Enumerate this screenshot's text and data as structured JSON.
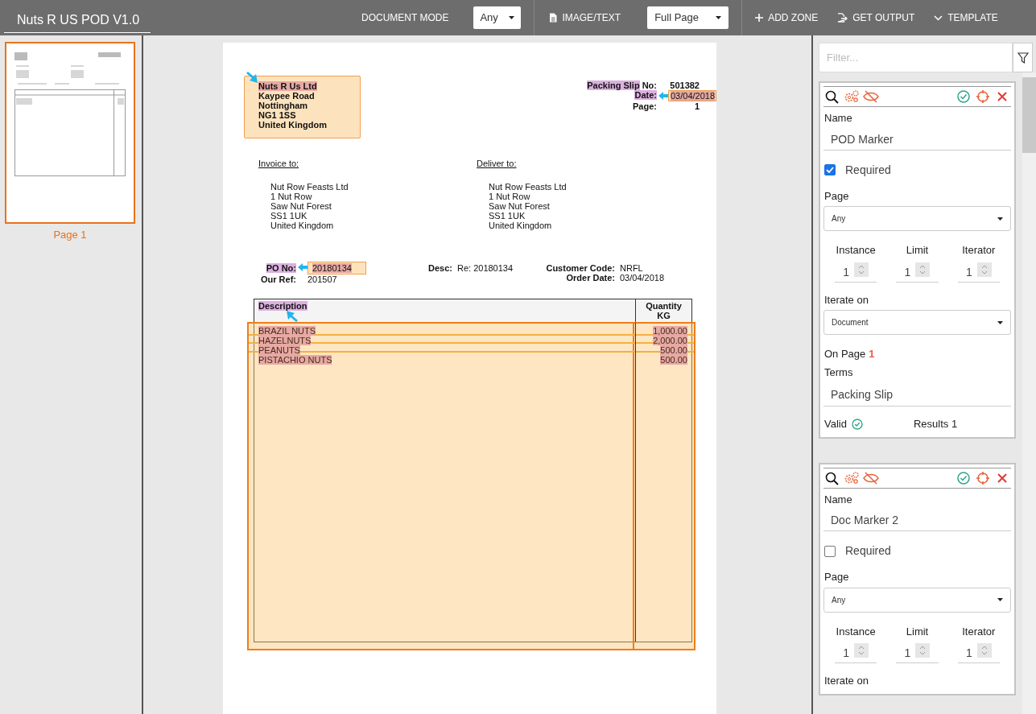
{
  "app": {
    "title": "Nuts R US POD V1.0"
  },
  "toolbar": {
    "mode_label": "DOCUMENT MODE",
    "mode": "Any",
    "image_text": "IMAGE/TEXT",
    "view": "Full Page",
    "actions": [
      {
        "kind": "plus",
        "label": "ADD ZONE"
      },
      {
        "kind": "output",
        "label": "GET OUTPUT"
      },
      {
        "kind": "chevron",
        "label": "TEMPLATE"
      }
    ]
  },
  "pages": [
    {
      "label": "Page 1",
      "selected": true
    }
  ],
  "document": {
    "sender": [
      {
        "text": "Nuts R Us Ltd",
        "highlight": true
      },
      {
        "text": "Kaypee Road",
        "highlight": false
      },
      {
        "text": "Nottingham",
        "highlight": false
      },
      {
        "text": "NG1 1SS",
        "highlight": false
      },
      {
        "text": "United Kingdom",
        "highlight": false
      }
    ],
    "slip_fields": [
      {
        "label": "Packing Slip",
        "label_highlight": true,
        "label_rest": "No:",
        "value": "501382",
        "zone": false
      },
      {
        "label": "Date:",
        "label_highlight": true,
        "value": "03/04/2018",
        "zone": true
      },
      {
        "label": "Page:",
        "label_highlight": false,
        "value": "1",
        "zone": false
      }
    ],
    "addresses": [
      {
        "heading": "Invoice to:",
        "lines": [
          "Nut Row Feasts Ltd",
          "1 Nut Row",
          "Saw Nut Forest",
          "SS1 1UK",
          "United Kingdom"
        ]
      },
      {
        "heading": "Deliver to:",
        "lines": [
          "Nut Row Feasts Ltd",
          "1 Nut Row",
          "Saw Nut Forest",
          "SS1 1UK",
          "United Kingdom"
        ]
      }
    ],
    "refs_left": [
      {
        "label": "PO No:",
        "label_highlight": true,
        "value": "20180134",
        "zone": true
      },
      {
        "label": "Our Ref:",
        "label_highlight": false,
        "value": "201507",
        "zone": false
      }
    ],
    "desc": {
      "label": "Desc:",
      "value": "Re: 20180134"
    },
    "refs_right": [
      {
        "label": "Customer Code:",
        "value": "NRFL"
      },
      {
        "label": "Order Date:",
        "value": "03/04/2018"
      }
    ],
    "table": {
      "columns": [
        {
          "label": "Description",
          "highlight": true
        },
        {
          "label": "Quantity KG",
          "highlight": false
        }
      ],
      "rows": [
        [
          "BRAZIL NUTS",
          "1,000.00"
        ],
        [
          "HAZELNUTS",
          "2,000.00"
        ],
        [
          "PEANUTS",
          "500.00"
        ],
        [
          "PISTACHIO NUTS",
          "500.00"
        ]
      ]
    }
  },
  "filter": {
    "placeholder": "Filter..."
  },
  "markers": [
    {
      "name_label": "Name",
      "name": "POD Marker",
      "required_label": "Required",
      "required": true,
      "page_label": "Page",
      "page": "Any",
      "counters": [
        {
          "label": "Instance",
          "value": "1"
        },
        {
          "label": "Limit",
          "value": "1"
        },
        {
          "label": "Iterator",
          "value": "1"
        }
      ],
      "iterate_on_label": "Iterate on",
      "iterate_on": "Document",
      "on_page_label": "On Page",
      "on_page": "1",
      "terms_label": "Terms",
      "terms": "Packing Slip",
      "valid_label": "Valid",
      "valid": true,
      "results": "Results 1"
    },
    {
      "name_label": "Name",
      "name": "Doc Marker 2",
      "required_label": "Required",
      "required": false,
      "page_label": "Page",
      "page": "Any",
      "counters": [
        {
          "label": "Instance",
          "value": "1"
        },
        {
          "label": "Limit",
          "value": "1"
        },
        {
          "label": "Iterator",
          "value": "1"
        }
      ],
      "iterate_on_label": "Iterate on"
    }
  ]
}
